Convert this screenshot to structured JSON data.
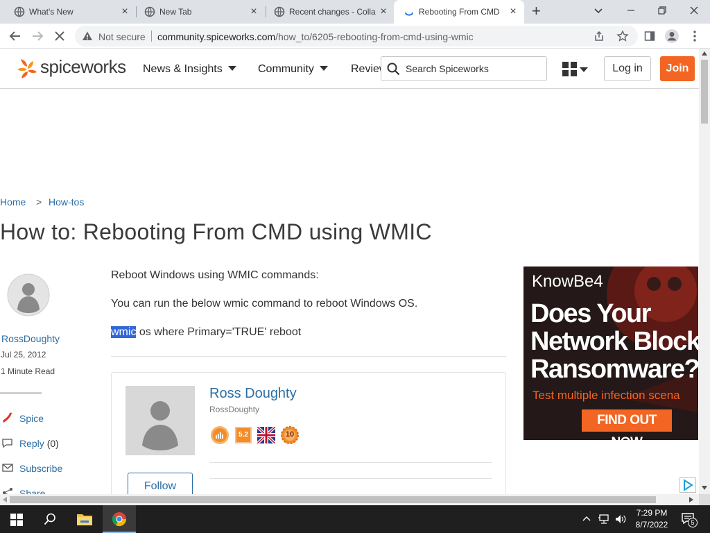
{
  "tabs": [
    {
      "title": "What's New",
      "icon": "globe-icon"
    },
    {
      "title": "New Tab",
      "icon": "globe-icon"
    },
    {
      "title": "Recent changes - Colla",
      "icon": "globe-icon"
    },
    {
      "title": "Rebooting From CMD",
      "icon": "loading-icon"
    }
  ],
  "toolbar": {
    "security": "Not secure",
    "url_host": "community.spiceworks.com",
    "url_path": "/how_to/6205-rebooting-from-cmd-using-wmic"
  },
  "site": {
    "logo_text": "spiceworks",
    "nav": [
      "News & Insights",
      "Community",
      "Reviews"
    ],
    "search_placeholder": "Search Spiceworks",
    "login": "Log in",
    "join": "Join",
    "brand_color": "#f26522"
  },
  "breadcrumb": {
    "home": "Home",
    "sep": ">",
    "section": "How-tos"
  },
  "article": {
    "title": "How to: Rebooting From CMD using WMIC",
    "author": "RossDoughty",
    "date": "Jul 25, 2012",
    "read_time": "1 Minute Read",
    "p1": "Reboot Windows using WMIC commands:",
    "p2": "You can run the below wmic command to reboot Windows OS.",
    "cmd_selected": "wmic",
    "cmd_rest": " os where Primary='TRUE' reboot"
  },
  "actions": {
    "spice": "Spice",
    "reply": "Reply",
    "reply_count": "(0)",
    "subscribe": "Subscribe",
    "share": "Share"
  },
  "author_card": {
    "name": "Ross Doughty",
    "username": "RossDoughty",
    "follow": "Follow",
    "badge_level": "5.2",
    "badge_count": "10"
  },
  "ad": {
    "brand": "KnowBe4",
    "headline_1": "Does Your",
    "headline_2": "Network Block",
    "headline_3": "Ransomware?",
    "subline": "Test multiple infection scena",
    "cta": "FIND OUT NOW"
  },
  "taskbar": {
    "time": "7:29 PM",
    "date": "8/7/2022",
    "notifications": "5"
  }
}
